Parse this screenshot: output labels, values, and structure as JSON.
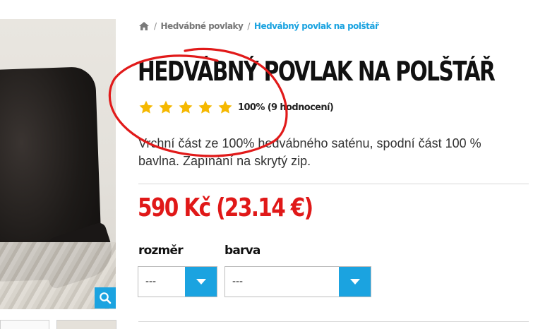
{
  "breadcrumb": {
    "home_icon": "home-icon",
    "items": [
      "Hedvábné povlaky",
      "Hedvábný povlak na polštář"
    ],
    "separator": "/"
  },
  "product": {
    "title": "HEDVÁBNÝ POVLAK NA POLŠTÁŘ",
    "rating": {
      "stars": 5,
      "stars_max": 5,
      "text": "100% (9 hodnocení)"
    },
    "description": "Vrchní část ze 100% hedvábného saténu, spodní část 100 % bavlna. Zapínání na skrytý zip.",
    "price": "590 Kč (23.14 €)"
  },
  "variants": {
    "size": {
      "label": "rozměr",
      "value": "---"
    },
    "color": {
      "label": "barva",
      "value": "---"
    }
  },
  "colors": {
    "accent": "#1ba3e0",
    "price": "#e01818",
    "star": "#f5b800",
    "annotation": "#e11a1a"
  }
}
